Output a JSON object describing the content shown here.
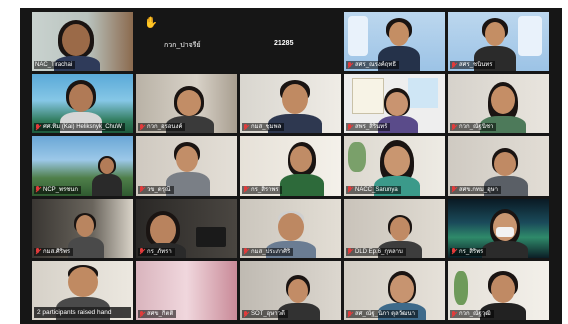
{
  "meeting": {
    "raised_hands_notice": "2 participants raised hand",
    "hand_tile_name": "กวก_ปาจรีย์",
    "hand_tile_number": "21285",
    "hand_tile_name_small": "กวก_ปาจรีย์",
    "hand_tile_number_small": "21285"
  },
  "participants": [
    {
      "name": "NAC_Tirachai",
      "muted": false
    },
    {
      "name": "",
      "muted": false
    },
    {
      "name": "สศร_ณรงค์ฤทธิ์",
      "muted": true
    },
    {
      "name": "สศร_ชนินทร",
      "muted": true
    },
    {
      "name": "ศศ.ทิม (Kai) Heliksnyk_ChuW",
      "muted": true
    },
    {
      "name": "กวก_อรอนงค์",
      "muted": true
    },
    {
      "name": "กมส_ชุมพล",
      "muted": true
    },
    {
      "name": "สพร_สิรินทร์",
      "muted": true
    },
    {
      "name": "กวก_ณัฐนิชา",
      "muted": true
    },
    {
      "name": "NCP_พรชนก",
      "muted": true
    },
    {
      "name": "วข_ดรุณี",
      "muted": true
    },
    {
      "name": "กร_สิราพร",
      "muted": true
    },
    {
      "name": "NACC_Sarunya",
      "muted": true
    },
    {
      "name": "สศข.กทม_อุษา",
      "muted": true
    },
    {
      "name": "กมส.ศิริพร",
      "muted": true
    },
    {
      "name": "กร_ภัทรา",
      "muted": true
    },
    {
      "name": "กมส_ประภาศิริ",
      "muted": true
    },
    {
      "name": "DLD Ep.6_กุหลาบ",
      "muted": true
    },
    {
      "name": "กร_สิริพร",
      "muted": true
    },
    {
      "name": "",
      "muted": false
    },
    {
      "name": "สศข_กิตติ",
      "muted": true
    },
    {
      "name": "SOT_อุษาวดี",
      "muted": true
    },
    {
      "name": "สศ_ณัฐ_นิภา ตุลวัฒนา",
      "muted": true
    },
    {
      "name": "กวก_ณัฐวุฒิ",
      "muted": true
    }
  ],
  "colors": {
    "active_speaker": "#2fd35a",
    "muted_mic": "#e23b3b",
    "background": "#161616"
  }
}
